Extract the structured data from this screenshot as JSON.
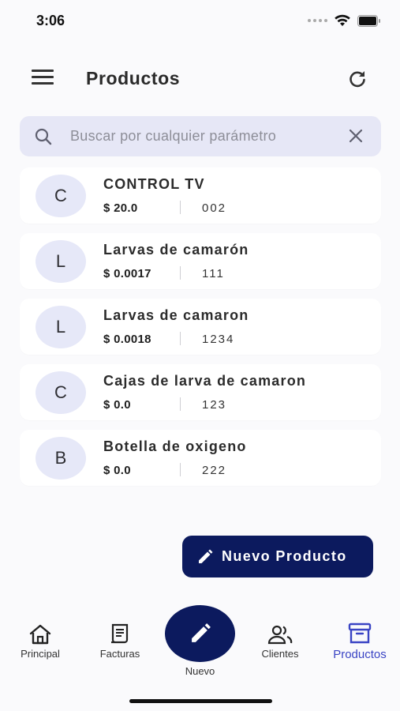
{
  "status_bar": {
    "time": "3:06"
  },
  "app_bar": {
    "title": "Productos"
  },
  "search": {
    "placeholder": "Buscar por cualquier parámetro",
    "value": ""
  },
  "products": [
    {
      "initial": "C",
      "name": "CONTROL TV",
      "price": "$ 20.0",
      "code": "002"
    },
    {
      "initial": "L",
      "name": "Larvas de camarón",
      "price": "$ 0.0017",
      "code": "111"
    },
    {
      "initial": "L",
      "name": "Larvas de camaron",
      "price": "$ 0.0018",
      "code": "1234"
    },
    {
      "initial": "C",
      "name": "Cajas de larva de camaron",
      "price": "$ 0.0",
      "code": "123"
    },
    {
      "initial": "B",
      "name": "Botella de oxigeno",
      "price": "$ 0.0",
      "code": "222"
    }
  ],
  "fab": {
    "label": "Nuevo Producto"
  },
  "bottom_nav": {
    "items": [
      {
        "label": "Principal",
        "icon": "home-icon"
      },
      {
        "label": "Facturas",
        "icon": "receipt-icon"
      },
      {
        "label": "Nuevo",
        "icon": "pencil-icon"
      },
      {
        "label": "Clientes",
        "icon": "people-icon"
      },
      {
        "label": "Productos",
        "icon": "archive-box-icon",
        "active": true
      }
    ]
  },
  "colors": {
    "primary": "#0c1a5e",
    "active_nav": "#3a44c4",
    "search_bg": "#e6e7f6",
    "avatar_bg": "#e6e8f8",
    "background": "#fafafc"
  }
}
